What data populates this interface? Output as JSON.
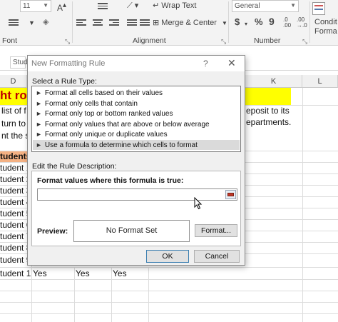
{
  "ribbon": {
    "font_size_value": "11",
    "wrap_text_label": "Wrap Text",
    "merge_center_label": "Merge & Center",
    "number_format_value": "General",
    "currency_symbol": "$",
    "percent_symbol": "%",
    "comma_symbol": "9",
    "conditional_label_1": "Condit",
    "conditional_label_2": "Forma",
    "group_font": "Font",
    "group_alignment": "Alignment",
    "group_number": "Number"
  },
  "sheet": {
    "cell_stud": "Stud",
    "col_d": "D",
    "col_k": "K",
    "col_l": "L",
    "row_title_fragment": "ht rov",
    "text_line1_left": "list of f",
    "text_line2_left": "turn to c",
    "text_line3_left": "nt the st",
    "text_line1_right": "eposit to its",
    "text_line2_right": "epartments.",
    "header_students": "tudents",
    "students": [
      "tudent 1",
      "tudent 2",
      "tudent 3",
      "tudent 4",
      "tudent 5",
      "tudent 6",
      "tudent 7",
      "tudent 8",
      "tudent 9"
    ],
    "last_row": {
      "name": "tudent 1",
      "v1": "Yes",
      "v2": "Yes",
      "v3": "Yes"
    }
  },
  "dialog": {
    "title": "New Formatting Rule",
    "help": "?",
    "close": "✕",
    "select_rule_type_label": "Select a Rule Type:",
    "rule_types": [
      "Format all cells based on their values",
      "Format only cells that contain",
      "Format only top or bottom ranked values",
      "Format only values that are above or below average",
      "Format only unique or duplicate values",
      "Use a formula to determine which cells to format"
    ],
    "selected_index": 5,
    "edit_desc_label": "Edit the Rule Description:",
    "formula_label": "Format values where this formula is true:",
    "formula_value": "",
    "preview_label": "Preview:",
    "preview_text": "No Format Set",
    "format_button": "Format...",
    "ok_button": "OK",
    "cancel_button": "Cancel"
  },
  "colors": {
    "title_yellow": "#ffff00",
    "header_orange": "#f4b183",
    "selection_gray": "#dadada"
  }
}
